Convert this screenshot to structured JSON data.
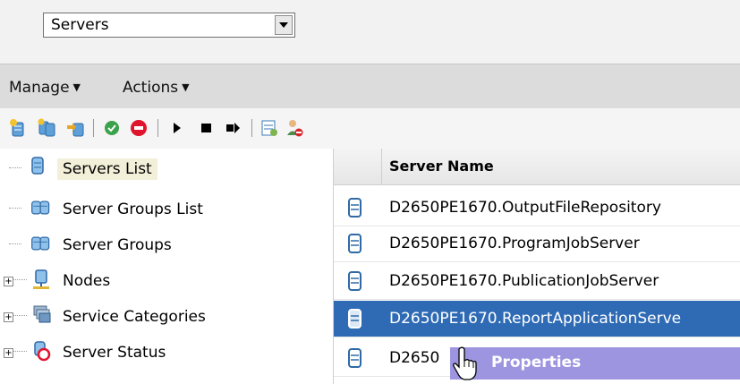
{
  "view_selector": {
    "value": "Servers"
  },
  "menubar": {
    "manage_label": "Manage",
    "actions_label": "Actions"
  },
  "toolbar": {
    "icons": [
      "new-server-icon",
      "clone-server-icon",
      "move-server-icon",
      "enable-server-icon",
      "disable-server-icon",
      "start-server-icon",
      "stop-server-icon",
      "restart-server-icon",
      "metrics-icon",
      "user-remove-icon"
    ]
  },
  "tree": {
    "items": [
      {
        "label": "Servers List",
        "icon": "server-icon"
      },
      {
        "label": "Server Groups List",
        "icon": "server-group-icon"
      },
      {
        "label": "Server Groups",
        "icon": "server-group-icon"
      },
      {
        "label": "Nodes",
        "icon": "node-icon"
      },
      {
        "label": "Service Categories",
        "icon": "service-category-icon"
      },
      {
        "label": "Server Status",
        "icon": "server-status-icon"
      }
    ]
  },
  "grid": {
    "column_header": "Server Name",
    "rows": [
      {
        "name": "D2650PE1670.OutputFileRepository"
      },
      {
        "name": "D2650PE1670.ProgramJobServer"
      },
      {
        "name": "D2650PE1670.PublicationJobServer"
      },
      {
        "name": "D2650PE1670.ReportApplicationServe"
      },
      {
        "name": "D2650"
      }
    ]
  },
  "context_menu": {
    "item": "Properties"
  },
  "colors": {
    "selection": "#2f6bb5",
    "context_menu": "#9d95e0",
    "tree_selection": "#f3f0d9"
  }
}
